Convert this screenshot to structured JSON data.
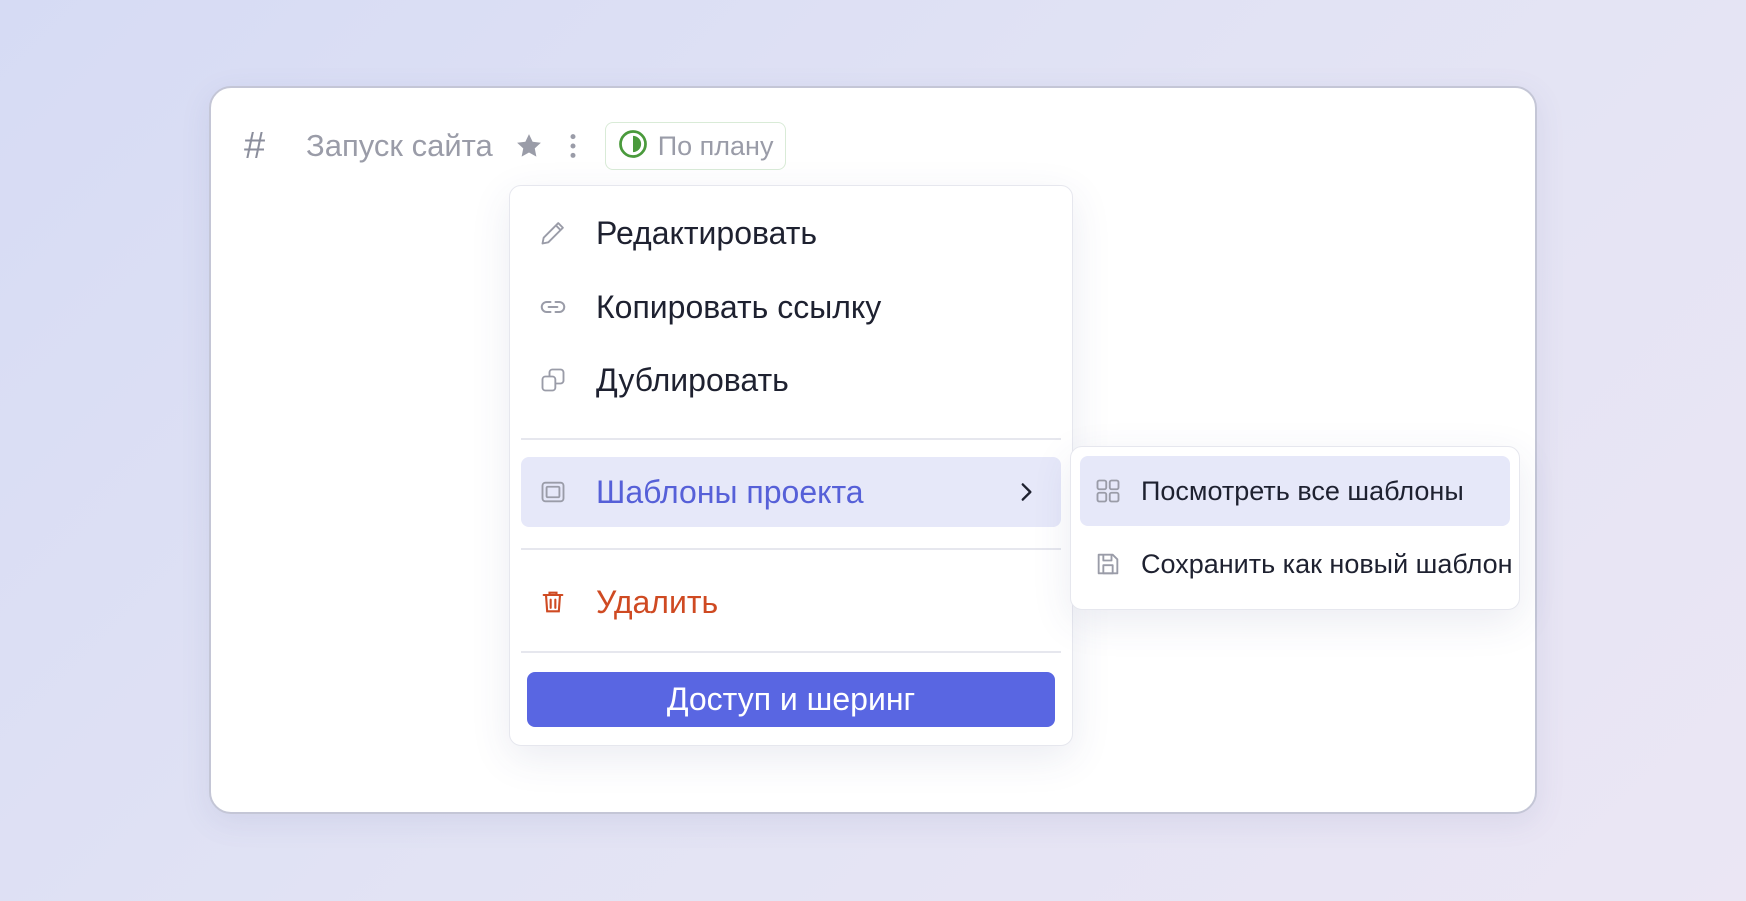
{
  "header": {
    "title": "Запуск сайта",
    "hash_icon": "hash-icon",
    "star_icon": "star-icon",
    "more_icon": "more-vertical-icon",
    "status": {
      "label": "По плану",
      "icon": "half-circle-status-icon",
      "color": "#4a9a3c"
    }
  },
  "menu": {
    "items": [
      {
        "label": "Редактировать",
        "icon": "pencil-icon"
      },
      {
        "label": "Копировать ссылку",
        "icon": "link-icon"
      },
      {
        "label": "Дублировать",
        "icon": "duplicate-icon"
      },
      {
        "label": "Шаблоны проекта",
        "icon": "template-icon",
        "active": true
      },
      {
        "label": "Удалить",
        "icon": "trash-icon",
        "danger": true
      }
    ],
    "share_button": "Доступ и шеринг"
  },
  "submenu": {
    "items": [
      {
        "label": "Посмотреть все шаблоны",
        "icon": "grid-icon",
        "active": true
      },
      {
        "label": "Сохранить как новый шаблон",
        "icon": "save-icon"
      }
    ]
  },
  "colors": {
    "accent": "#5966e2",
    "active_text": "#5660d8",
    "active_bg": "#e6e8f9",
    "danger": "#cf4a22",
    "status_green": "#4a9a3c"
  }
}
